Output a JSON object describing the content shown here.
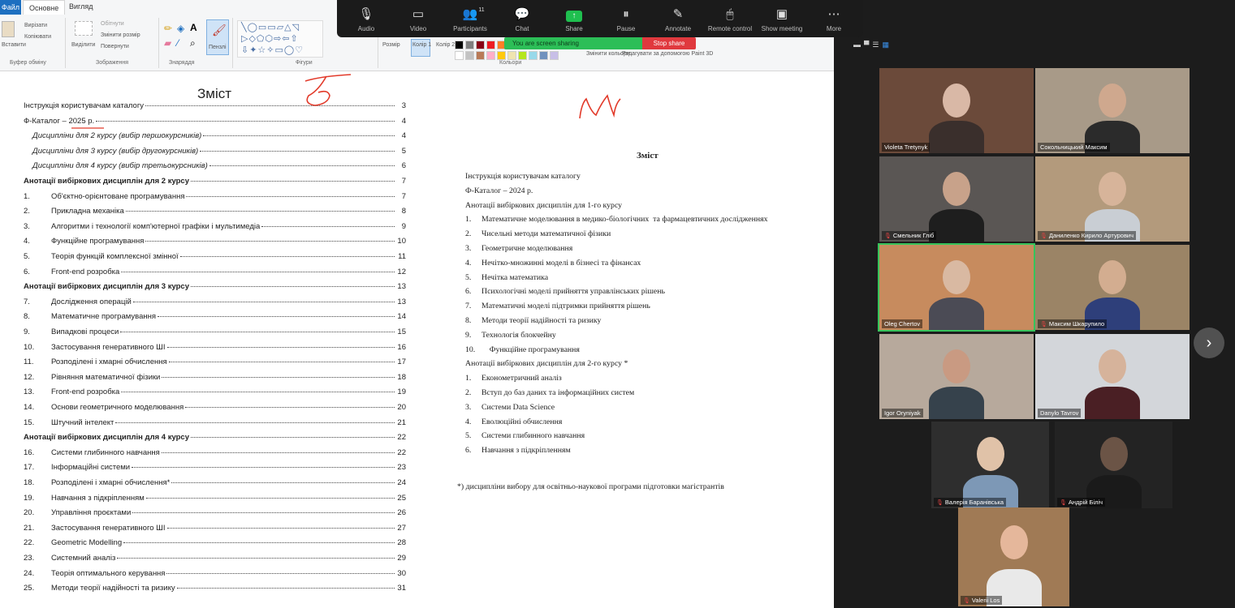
{
  "ribbon": {
    "tabs": {
      "file": "Файл",
      "home": "Основне",
      "view": "Вигляд"
    },
    "clipboard": {
      "paste": "Вставити",
      "cut": "Вирізати",
      "copy": "Копіювати",
      "label": "Буфер обміну"
    },
    "image": {
      "select": "Виділити",
      "crop": "Обітнути",
      "resize": "Змінити розмір",
      "rotate": "Повернути",
      "label": "Зображення"
    },
    "tools": {
      "label": "Знаряддя",
      "brushes": "Пензлі"
    },
    "shapes": {
      "label": "Фігури"
    },
    "size": {
      "label": "Розмір"
    },
    "color1": "Колір 1",
    "color2": "Колір 2",
    "colors": {
      "label": "Кольори",
      "edit": "Змінити кольори"
    },
    "paint3d": "Редагувати за допомогою Paint 3D",
    "palette_row1": [
      "#000000",
      "#7f7f7f",
      "#880015",
      "#ed1c24",
      "#ff7f27",
      "#fff200",
      "#22b14c",
      "#00a2e8",
      "#3f48cc",
      "#a349a4"
    ],
    "palette_row2": [
      "#ffffff",
      "#c3c3c3",
      "#b97a57",
      "#ffaec9",
      "#ffc90e",
      "#efe4b0",
      "#b5e61d",
      "#99d9ea",
      "#7092be",
      "#c8bfe7"
    ]
  },
  "zoom_toolbar": {
    "buttons": [
      {
        "label": "Audio",
        "icon": "microphone-icon",
        "glyph": "🎙"
      },
      {
        "label": "Video",
        "icon": "video-camera-icon",
        "glyph": "▭"
      },
      {
        "label": "Participants",
        "icon": "participants-icon",
        "glyph": "👥",
        "count": "11"
      },
      {
        "label": "Chat",
        "icon": "chat-icon",
        "glyph": "💬"
      },
      {
        "label": "Share",
        "icon": "share-screen-icon",
        "glyph": "↑"
      },
      {
        "label": "Pause",
        "icon": "pause-icon",
        "glyph": "⏸"
      },
      {
        "label": "Annotate",
        "icon": "pencil-icon",
        "glyph": "✎"
      },
      {
        "label": "Remote control",
        "icon": "mouse-icon",
        "glyph": "🖱"
      },
      {
        "label": "Show meeting",
        "icon": "show-meeting-icon",
        "glyph": "▣"
      },
      {
        "label": "More",
        "icon": "more-icon",
        "glyph": "⋯"
      }
    ],
    "share_banner": "You are screen sharing",
    "stop_share": "Stop share"
  },
  "document": {
    "toc_title": "Зміст",
    "toc": [
      {
        "num": "",
        "text": "Інструкція користувачам каталогу",
        "page": "3",
        "style": ""
      },
      {
        "num": "",
        "text": "Ф-Каталог – 2025 р.",
        "page": "4",
        "style": ""
      },
      {
        "num": "",
        "text": "Дисципліни для 2 курсу (вибір першокурсників)",
        "page": "4",
        "style": "italic indent"
      },
      {
        "num": "",
        "text": "Дисципліни для 3 курсу (вибір другокурсників)",
        "page": "5",
        "style": "italic indent"
      },
      {
        "num": "",
        "text": "Дисципліни для 4 курсу (вибір третьокурсників)",
        "page": "6",
        "style": "italic indent"
      },
      {
        "num": "",
        "text": "Анотації вибіркових дисциплін для 2 курсу",
        "page": "7",
        "style": "bold"
      },
      {
        "num": "1.",
        "text": "Об'єктно-орієнтоване програмування",
        "page": "7",
        "style": ""
      },
      {
        "num": "2.",
        "text": "Прикладна механіка",
        "page": "8",
        "style": ""
      },
      {
        "num": "3.",
        "text": "Алгоритми і технології комп'ютерної графіки і мультимедіа",
        "page": "9",
        "style": ""
      },
      {
        "num": "4.",
        "text": "Функційне програмування",
        "page": "10",
        "style": ""
      },
      {
        "num": "5.",
        "text": "Теорія функцій комплексної змінної",
        "page": "11",
        "style": ""
      },
      {
        "num": "6.",
        "text": "Front-end розробка",
        "page": "12",
        "style": ""
      },
      {
        "num": "",
        "text": "Анотації вибіркових дисциплін для 3 курсу",
        "page": "13",
        "style": "bold"
      },
      {
        "num": "7.",
        "text": "Дослідження операцій",
        "page": "13",
        "style": ""
      },
      {
        "num": "8.",
        "text": "Математичне програмування",
        "page": "14",
        "style": ""
      },
      {
        "num": "9.",
        "text": "Випадкові процеси",
        "page": "15",
        "style": ""
      },
      {
        "num": "10.",
        "text": "Застосування генеративного ШІ",
        "page": "16",
        "style": ""
      },
      {
        "num": "11.",
        "text": "Розподілені і хмарні обчислення",
        "page": "17",
        "style": ""
      },
      {
        "num": "12.",
        "text": "Рівняння математичної фізики",
        "page": "18",
        "style": ""
      },
      {
        "num": "13.",
        "text": "Front-end розробка",
        "page": "19",
        "style": ""
      },
      {
        "num": "14.",
        "text": "Основи геометричного моделювання",
        "page": "20",
        "style": ""
      },
      {
        "num": "15.",
        "text": "Штучний інтелект",
        "page": "21",
        "style": ""
      },
      {
        "num": "",
        "text": "Анотації вибіркових дисциплін для 4 курсу",
        "page": "22",
        "style": "bold"
      },
      {
        "num": "16.",
        "text": "Системи глибинного навчання",
        "page": "22",
        "style": ""
      },
      {
        "num": "17.",
        "text": "Інформаційні системи",
        "page": "23",
        "style": ""
      },
      {
        "num": "18.",
        "text": "Розподілені і хмарні обчислення*",
        "page": "24",
        "style": ""
      },
      {
        "num": "19.",
        "text": "Навчання з підкріпленням",
        "page": "25",
        "style": ""
      },
      {
        "num": "20.",
        "text": "Управління проєктами",
        "page": "26",
        "style": ""
      },
      {
        "num": "21.",
        "text": "Застосування генеративного ШІ",
        "page": "27",
        "style": ""
      },
      {
        "num": "22.",
        "text": "Geometric Modelling",
        "page": "28",
        "style": ""
      },
      {
        "num": "23.",
        "text": "Системний аналіз",
        "page": "29",
        "style": ""
      },
      {
        "num": "24.",
        "text": "Теорія оптимального керування",
        "page": "30",
        "style": ""
      },
      {
        "num": "25.",
        "text": "Методи теорії надійності та ризику",
        "page": "31",
        "style": ""
      }
    ],
    "doc2_title": "Зміст",
    "doc2_rows": [
      {
        "num": "",
        "text": "Інструкція користувачам каталогу"
      },
      {
        "num": "",
        "text": "Ф-Каталог – 2024 р."
      },
      {
        "num": "",
        "text": "Анотації вибіркових дисциплін для 1-го курсу"
      },
      {
        "num": "1.",
        "text": "Математичне моделювання в медико-біологічних  та фармацевтичних дослідженнях"
      },
      {
        "num": "2.",
        "text": "Чисельні методи математичної фізики"
      },
      {
        "num": "3.",
        "text": "Геометричне моделювання"
      },
      {
        "num": "4.",
        "text": "Нечітко-множинні моделі в бізнесі та фінансах"
      },
      {
        "num": "5.",
        "text": "Нечітка математика"
      },
      {
        "num": "6.",
        "text": "Психологічні моделі прийняття управлінських рішень"
      },
      {
        "num": "7.",
        "text": "Математичні моделі підтримки прийняття рішень"
      },
      {
        "num": "8.",
        "text": "Методи теорії надійності та ризику"
      },
      {
        "num": "9.",
        "text": "Технологія блокчейну"
      },
      {
        "num": "10.",
        "text": "    Функційне програмування"
      },
      {
        "num": "",
        "text": "Анотації вибіркових дисциплін для 2-го курсу *"
      },
      {
        "num": "1.",
        "text": "Економетричний аналіз"
      },
      {
        "num": "2.",
        "text": "Вступ до баз даних та інформаційних систем"
      },
      {
        "num": "3.",
        "text": "Системи Data Science"
      },
      {
        "num": "4.",
        "text": "Еволюційні обчислення"
      },
      {
        "num": "5.",
        "text": "Системи глибинного навчання"
      },
      {
        "num": "6.",
        "text": "Навчання з підкріпленням"
      }
    ],
    "doc2_footnote": "*) дисципліни вибору для освітньо-наукової програми підготовки магістрантів"
  },
  "gallery": {
    "participants": [
      {
        "name": "Violeta Tretynyk",
        "bg": "#6b4a3a",
        "skin": "#d9b8a6",
        "shirt": "#3a2f2c",
        "muted": false
      },
      {
        "name": "Сокольницький Максим",
        "bg": "#a89a88",
        "skin": "#cfa88e",
        "shirt": "#2b2b2b",
        "muted": false
      },
      {
        "name": "Смельник Гліб",
        "bg": "#5a5654",
        "skin": "#c8a28a",
        "shirt": "#1e1e1e",
        "muted": true
      },
      {
        "name": "Даниленко Кирило Артурович",
        "bg": "#b39a7c",
        "skin": "#d7b49a",
        "shirt": "#c9ced4",
        "muted": true
      },
      {
        "name": "Oleg Chertov",
        "bg": "#c78b5e",
        "skin": "#d9b9a2",
        "shirt": "#4b4b55",
        "muted": false
      },
      {
        "name": "Максим Шкарупило",
        "bg": "#9b8466",
        "skin": "#d3ad90",
        "shirt": "#2e3f7a",
        "muted": true
      },
      {
        "name": "Igor Oryniyak",
        "bg": "#b7a99c",
        "skin": "#c99a82",
        "shirt": "#36424c",
        "muted": false
      },
      {
        "name": "Danylo Tavrov",
        "bg": "#d3d6da",
        "skin": "#d6b39b",
        "shirt": "#4a1f24",
        "muted": false
      },
      {
        "name": "Валерія Баранівська",
        "bg": "#2e2e2e",
        "skin": "#e0c2a8",
        "shirt": "#7d98b6",
        "muted": true
      },
      {
        "name": "Андрій Біліч",
        "bg": "#232323",
        "skin": "#6b5446",
        "shirt": "#1a1a1a",
        "muted": true
      },
      {
        "name": "Valerii Los",
        "bg": "#a07a55",
        "skin": "#e5b79b",
        "shirt": "#e9e9e9",
        "muted": true
      }
    ]
  }
}
